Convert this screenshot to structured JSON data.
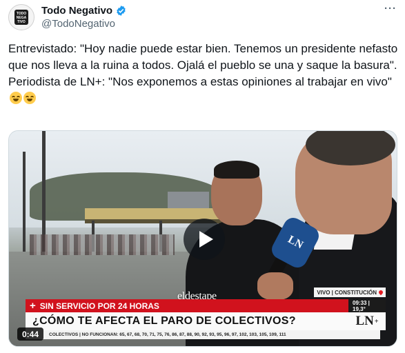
{
  "author": {
    "display_name": "Todo Negativo",
    "handle": "@TodoNegativo",
    "avatar_text": "TODO NEGA TIVO",
    "verified": true
  },
  "menu": {
    "label": "···"
  },
  "tweet": {
    "line1": "Entrevistado: \"Hoy nadie puede estar bien. Tenemos un presidente nefasto que nos lleva a la ruina a todos. Ojalá el pueblo se una y saque la basura\".",
    "line2": "Periodista de LN+: \"Nos exponemos a estas opiniones al trabajar en vivo\""
  },
  "video": {
    "watermark": "eldestape",
    "live_tag": "VIVO | CONSTITUCIÓN",
    "red_band": "SIN SERVICIO POR 24 HORAS",
    "red_band_icon": "+",
    "clock": "09:33 | 19,3°",
    "headline": "¿CÓMO TE AFECTA EL PARO DE COLECTIVOS?",
    "channel_logo": "LN",
    "channel_logo_sup": "+",
    "ticker": "COLECTIVOS | NO FUNCIONAN: 65, 67, 68, 70, 71, 75, 76, 86, 87, 88, 90, 92, 93, 95, 96, 97, 102, 103, 105, 109, 111",
    "duration": "0:44",
    "mic_logo": "LN"
  },
  "colors": {
    "red_band": "#d1121d",
    "verified_blue": "#1d9bf0",
    "handle_gray": "#536471"
  }
}
